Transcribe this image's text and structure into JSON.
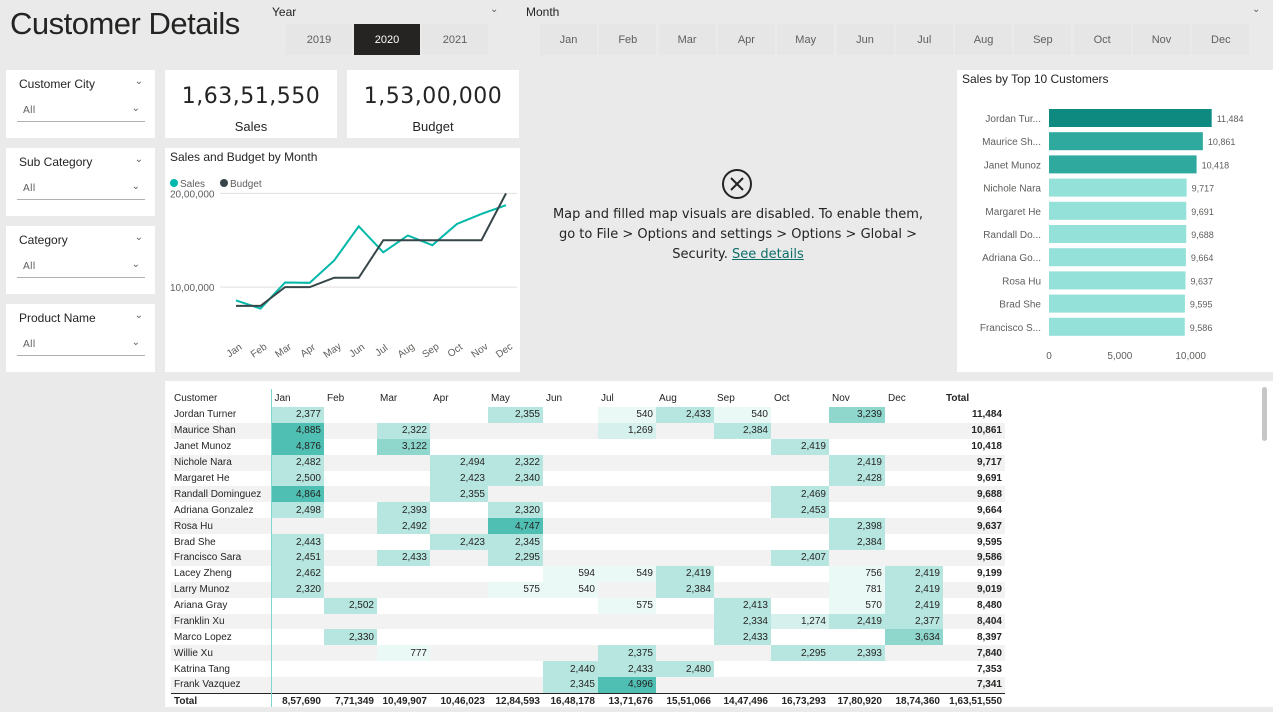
{
  "header": {
    "title": "Customer Details",
    "year_label": "Year",
    "month_label": "Month",
    "years": [
      {
        "label": "2019",
        "selected": false
      },
      {
        "label": "2020",
        "selected": true
      },
      {
        "label": "2021",
        "selected": false
      }
    ],
    "months": [
      "Jan",
      "Feb",
      "Mar",
      "Apr",
      "May",
      "Jun",
      "Jul",
      "Aug",
      "Sep",
      "Oct",
      "Nov",
      "Dec"
    ]
  },
  "slicers": [
    {
      "title": "Customer City",
      "value": "All"
    },
    {
      "title": "Sub Category",
      "value": "All"
    },
    {
      "title": "Category",
      "value": "All"
    },
    {
      "title": "Product Name",
      "value": "All"
    }
  ],
  "kpis": {
    "sales": {
      "value": "1,63,51,550",
      "label": "Sales"
    },
    "budget": {
      "value": "1,53,00,000",
      "label": "Budget"
    }
  },
  "map_message": {
    "text": "Map and filled map visuals are disabled. To enable them, go to File > Options and settings > Options > Global > Security.",
    "link": "See details"
  },
  "colors": {
    "accent": "#01b8aa",
    "dark": "#374649",
    "bar_top": "#0e8a80",
    "bar_mid": "#2fa89e",
    "bar_light": "#93e1d9"
  },
  "chart_data": [
    {
      "type": "line",
      "title": "Sales and Budget by Month",
      "categories": [
        "Jan",
        "Feb",
        "Mar",
        "Apr",
        "May",
        "Jun",
        "Jul",
        "Aug",
        "Sep",
        "Oct",
        "Nov",
        "Dec"
      ],
      "series": [
        {
          "name": "Sales",
          "color": "#01b8aa",
          "values": [
            857690,
            771349,
            1049907,
            1046023,
            1284593,
            1648178,
            1371676,
            1551066,
            1447496,
            1673293,
            1780920,
            1874360
          ]
        },
        {
          "name": "Budget",
          "color": "#374649",
          "values": [
            800000,
            800000,
            1000000,
            1000000,
            1100000,
            1100000,
            1500000,
            1500000,
            1500000,
            1500000,
            1500000,
            2000000
          ]
        }
      ],
      "y_ticks": [
        {
          "value": 1000000,
          "label": "10,00,000"
        },
        {
          "value": 2000000,
          "label": "20,00,000"
        }
      ],
      "ylim": [
        500000,
        2100000
      ],
      "legend": "top-left"
    },
    {
      "type": "bar",
      "title": "Sales by Top 10 Customers",
      "categories": [
        "Jordan Tur...",
        "Maurice Sh...",
        "Janet Munoz",
        "Nichole Nara",
        "Margaret He",
        "Randall Do...",
        "Adriana Go...",
        "Rosa Hu",
        "Brad She",
        "Francisco S..."
      ],
      "values": [
        11484,
        10861,
        10418,
        9717,
        9691,
        9688,
        9664,
        9637,
        9595,
        9586
      ],
      "value_labels": [
        "11,484",
        "10,861",
        "10,418",
        "9,717",
        "9,691",
        "9,688",
        "9,664",
        "9,637",
        "9,595",
        "9,586"
      ],
      "x_ticks": [
        {
          "value": 0,
          "label": "0"
        },
        {
          "value": 5000,
          "label": "5,000"
        },
        {
          "value": 10000,
          "label": "10,000"
        }
      ],
      "xlim": [
        0,
        12000
      ]
    }
  ],
  "matrix": {
    "headers": [
      "Customer",
      "Jan",
      "Feb",
      "Mar",
      "Apr",
      "May",
      "Jun",
      "Jul",
      "Aug",
      "Sep",
      "Oct",
      "Nov",
      "Dec",
      "Total"
    ],
    "rows": [
      {
        "name": "Jordan Turner",
        "cells": [
          2377,
          null,
          null,
          null,
          2355,
          null,
          540,
          2433,
          540,
          null,
          3239,
          null
        ],
        "total": "11,484"
      },
      {
        "name": "Maurice Shan",
        "cells": [
          4885,
          null,
          2322,
          null,
          null,
          null,
          1269,
          null,
          2384,
          null,
          null,
          null
        ],
        "total": "10,861"
      },
      {
        "name": "Janet Munoz",
        "cells": [
          4876,
          null,
          3122,
          null,
          null,
          null,
          null,
          null,
          null,
          2419,
          null,
          null
        ],
        "total": "10,418"
      },
      {
        "name": "Nichole Nara",
        "cells": [
          2482,
          null,
          null,
          2494,
          2322,
          null,
          null,
          null,
          null,
          null,
          2419,
          null
        ],
        "total": "9,717"
      },
      {
        "name": "Margaret He",
        "cells": [
          2500,
          null,
          null,
          2423,
          2340,
          null,
          null,
          null,
          null,
          null,
          2428,
          null
        ],
        "total": "9,691"
      },
      {
        "name": "Randall Dominguez",
        "cells": [
          4864,
          null,
          null,
          2355,
          null,
          null,
          null,
          null,
          null,
          2469,
          null,
          null
        ],
        "total": "9,688"
      },
      {
        "name": "Adriana Gonzalez",
        "cells": [
          2498,
          null,
          2393,
          null,
          2320,
          null,
          null,
          null,
          null,
          2453,
          null,
          null
        ],
        "total": "9,664"
      },
      {
        "name": "Rosa Hu",
        "cells": [
          null,
          null,
          2492,
          null,
          4747,
          null,
          null,
          null,
          null,
          null,
          2398,
          null
        ],
        "total": "9,637"
      },
      {
        "name": "Brad She",
        "cells": [
          2443,
          null,
          null,
          2423,
          2345,
          null,
          null,
          null,
          null,
          null,
          2384,
          null
        ],
        "total": "9,595"
      },
      {
        "name": "Francisco Sara",
        "cells": [
          2451,
          null,
          2433,
          null,
          2295,
          null,
          null,
          null,
          null,
          2407,
          null,
          null
        ],
        "total": "9,586"
      },
      {
        "name": "Lacey Zheng",
        "cells": [
          2462,
          null,
          null,
          null,
          null,
          594,
          549,
          2419,
          null,
          null,
          756,
          2419
        ],
        "total": "9,199"
      },
      {
        "name": "Larry Munoz",
        "cells": [
          2320,
          null,
          null,
          null,
          575,
          540,
          null,
          2384,
          null,
          null,
          781,
          2419
        ],
        "total": "9,019"
      },
      {
        "name": "Ariana Gray",
        "cells": [
          null,
          2502,
          null,
          null,
          null,
          null,
          575,
          null,
          2413,
          null,
          570,
          2419
        ],
        "total": "8,480"
      },
      {
        "name": "Franklin Xu",
        "cells": [
          null,
          null,
          null,
          null,
          null,
          null,
          null,
          null,
          2334,
          1274,
          2419,
          2377
        ],
        "total": "8,404"
      },
      {
        "name": "Marco Lopez",
        "cells": [
          null,
          2330,
          null,
          null,
          null,
          null,
          null,
          null,
          2433,
          null,
          null,
          3634
        ],
        "total": "8,397"
      },
      {
        "name": "Willie Xu",
        "cells": [
          null,
          null,
          777,
          null,
          null,
          null,
          2375,
          null,
          null,
          2295,
          2393,
          null
        ],
        "total": "7,840"
      },
      {
        "name": "Katrina Tang",
        "cells": [
          null,
          null,
          null,
          null,
          null,
          2440,
          2433,
          2480,
          null,
          null,
          null,
          null
        ],
        "total": "7,353"
      },
      {
        "name": "Frank Vazquez",
        "cells": [
          null,
          null,
          null,
          null,
          null,
          2345,
          4996,
          null,
          null,
          null,
          null,
          null
        ],
        "total": "7,341"
      }
    ],
    "total_row": {
      "name": "Total",
      "cells": [
        "8,57,690",
        "7,71,349",
        "10,49,907",
        "10,46,023",
        "12,84,593",
        "16,48,178",
        "13,71,676",
        "15,51,066",
        "14,47,496",
        "16,73,293",
        "17,80,920",
        "18,74,360"
      ],
      "total": "1,63,51,550"
    }
  }
}
